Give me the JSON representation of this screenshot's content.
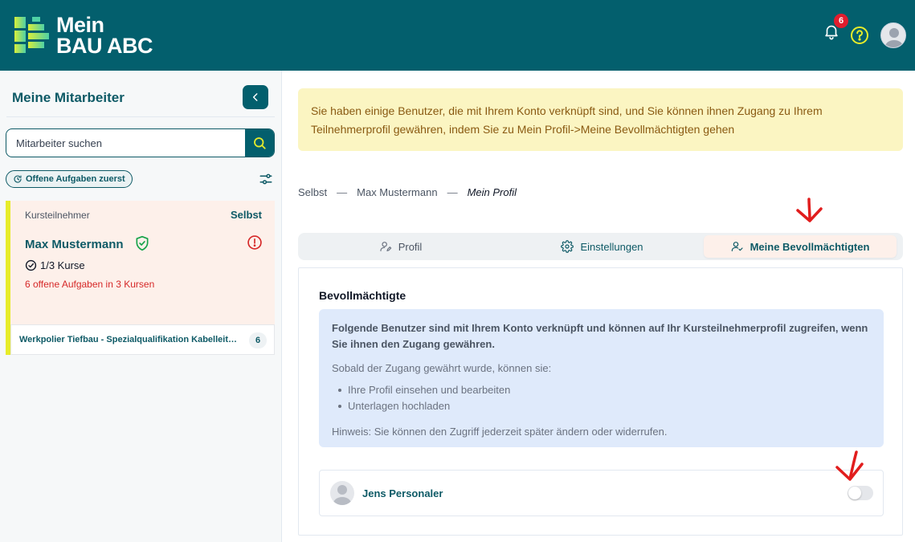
{
  "header": {
    "logo_line1": "Mein",
    "logo_line2": "BAU ABC",
    "notification_count": "6",
    "colors": {
      "bar": "#035f6d",
      "badge": "#e11d2e",
      "help": "#e7ec2a"
    },
    "icons": [
      "bell-icon",
      "help-icon",
      "user-avatar-icon"
    ]
  },
  "sidebar": {
    "title": "Meine Mitarbeiter",
    "search_placeholder": "Mitarbeiter suchen",
    "sort_chip": "Offene Aufgaben zuerst",
    "card": {
      "type": "Kursteilnehmer",
      "self_label": "Selbst",
      "name": "Max Mustermann",
      "courses": "1/3 Kurse",
      "open_tasks": "6 offene Aufgaben in 3 Kursen",
      "course_row": {
        "name": "Werkpolier Tiefbau - Spezialqualifikation Kabelleitungstiefbau",
        "count": "6"
      }
    }
  },
  "main": {
    "banner": "Sie haben einige Benutzer, die mit Ihrem Konto verknüpft sind, und Sie können ihnen Zugang zu Ihrem Teilnehmerprofil gewähren, indem Sie zu Mein Profil->Meine Bevollmächtigten gehen",
    "breadcrumb": [
      "Selbst",
      "Max Mustermann",
      "Mein Profil"
    ],
    "tabs": [
      {
        "label": "Profil",
        "icon": "user-edit-icon",
        "active": false
      },
      {
        "label": "Einstellungen",
        "icon": "gear-icon",
        "active": false
      },
      {
        "label": "Meine Bevollmächtigten",
        "icon": "user-check-icon",
        "active": true
      }
    ],
    "panel": {
      "title": "Bevollmächtigte",
      "info_strong": "Folgende Benutzer sind mit Ihrem Konto verknüpft und können auf Ihr Kursteilnehmerprofil zugreifen, wenn Sie ihnen den Zugang gewähren.",
      "info_intro": "Sobald der Zugang gewährt wurde, können sie:",
      "info_items": [
        "Ihre Profil einsehen und bearbeiten",
        "Unterlagen hochladen"
      ],
      "info_hint": "Hinweis: Sie können den Zugriff jederzeit später ändern oder widerrufen.",
      "person": {
        "name": "Jens Personaler",
        "access_enabled": false
      }
    }
  }
}
